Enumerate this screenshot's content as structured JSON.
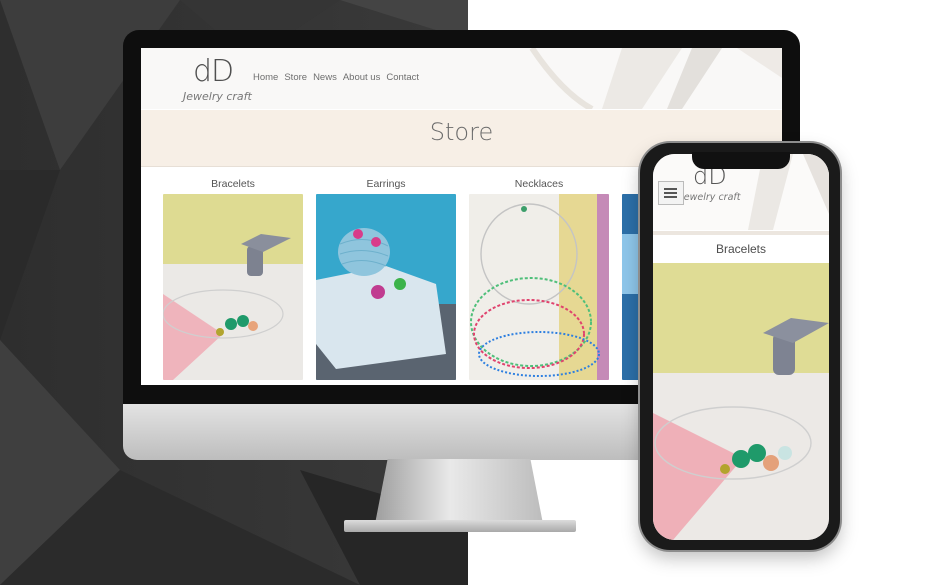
{
  "site": {
    "logo_mark": "dD",
    "logo_text": "Jewelry craft",
    "nav": [
      "Home",
      "Store",
      "News",
      "About us",
      "Contact"
    ],
    "page_title": "Store",
    "categories": [
      "Bracelets",
      "Earrings",
      "Necklaces"
    ]
  },
  "mobile": {
    "logo_mark": "dD",
    "logo_text": "Jewelry craft",
    "category": "Bracelets"
  },
  "colors": {
    "background_left": "#333333",
    "background_right": "#ffffff",
    "hero_band": "#f7efe6",
    "text": "#555555"
  }
}
